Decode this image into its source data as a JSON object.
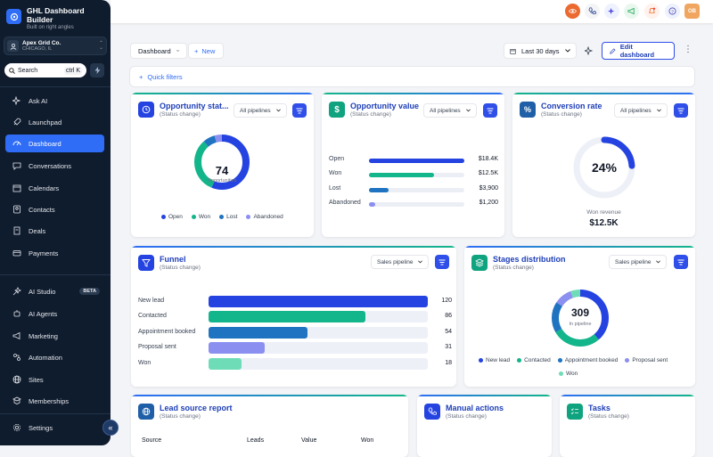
{
  "sidebar": {
    "brand_title": "GHL Dashboard Builder",
    "brand_sub": "Built on right angles",
    "account_name": "Apex Grid Co.",
    "account_location": "CHICAGO, IL",
    "search_label": "Search",
    "search_shortcut": "ctrl K",
    "nav": [
      {
        "label": "Ask AI",
        "icon": "sparkles-icon"
      },
      {
        "label": "Launchpad",
        "icon": "rocket-icon"
      },
      {
        "label": "Dashboard",
        "icon": "gauge-icon",
        "active": true
      },
      {
        "label": "Conversations",
        "icon": "chat-icon"
      },
      {
        "label": "Calendars",
        "icon": "calendar-icon"
      },
      {
        "label": "Contacts",
        "icon": "contacts-icon"
      },
      {
        "label": "Deals",
        "icon": "deals-icon"
      },
      {
        "label": "Payments",
        "icon": "card-icon"
      }
    ],
    "nav2": [
      {
        "label": "AI Studio",
        "icon": "studio-icon",
        "badge": "BETA"
      },
      {
        "label": "AI Agents",
        "icon": "agent-icon"
      },
      {
        "label": "Marketing",
        "icon": "megaphone-icon"
      },
      {
        "label": "Automation",
        "icon": "automation-icon"
      },
      {
        "label": "Sites",
        "icon": "globe-icon"
      },
      {
        "label": "Memberships",
        "icon": "members-icon"
      }
    ],
    "settings_label": "Settings",
    "avatar_initials": "OB"
  },
  "toolbar": {
    "dashboard_select": "Dashboard",
    "new_label": "New",
    "date_range": "Last 30 days",
    "edit_label": "Edit dashboard",
    "quick_filters": "Quick filters"
  },
  "cards": {
    "opp_status": {
      "title": "Opportunity stat...",
      "sub": "(Status change)",
      "pipeline": "All pipelines",
      "total": "74",
      "total_label": "Opportunities",
      "legend": [
        "Open",
        "Won",
        "Lost",
        "Abandoned"
      ]
    },
    "opp_value": {
      "title": "Opportunity value",
      "sub": "(Status change)",
      "pipeline": "All pipelines",
      "rows": [
        {
          "label": "Open",
          "value": "$18.4K",
          "fill": 1.0,
          "color": "#2443e0"
        },
        {
          "label": "Won",
          "value": "$12.5K",
          "fill": 0.68,
          "color": "#13b58a"
        },
        {
          "label": "Lost",
          "value": "$3,900",
          "fill": 0.21,
          "color": "#1f73c0"
        },
        {
          "label": "Abandoned",
          "value": "$1,200",
          "fill": 0.065,
          "color": "#8b8ff0"
        }
      ]
    },
    "conversion": {
      "title": "Conversion rate",
      "sub": "(Status change)",
      "pipeline": "All pipelines",
      "rate": "24%",
      "rate_fraction": 0.24,
      "won_label": "Won revenue",
      "won_value": "$12.5K"
    },
    "funnel": {
      "title": "Funnel",
      "sub": "(Status change)",
      "pipeline": "Sales pipeline",
      "rows": [
        {
          "label": "New lead",
          "value": "120",
          "fill": 1.0,
          "color": "#2443e0"
        },
        {
          "label": "Contacted",
          "value": "86",
          "fill": 0.717,
          "color": "#13b58a"
        },
        {
          "label": "Appointment booked",
          "value": "54",
          "fill": 0.45,
          "color": "#1f73c0"
        },
        {
          "label": "Proposal sent",
          "value": "31",
          "fill": 0.258,
          "color": "#8b8ff0"
        },
        {
          "label": "Won",
          "value": "18",
          "fill": 0.15,
          "color": "#6fdcb8"
        }
      ]
    },
    "stages": {
      "title": "Stages distribution",
      "sub": "(Status change)",
      "pipeline": "Sales pipeline",
      "total": "309",
      "total_label": "In pipeline",
      "legend": [
        "New lead",
        "Contacted",
        "Appointment booked",
        "Proposal sent",
        "Won"
      ]
    },
    "lead_source": {
      "title": "Lead source report",
      "sub": "(Status change)",
      "columns": [
        "Source",
        "Leads",
        "Value",
        "Won"
      ]
    },
    "manual": {
      "title": "Manual actions",
      "sub": "(Status change)"
    },
    "tasks": {
      "title": "Tasks",
      "sub": "(Status change)"
    }
  },
  "colors": {
    "blue": "#2443e0",
    "green": "#13b58a",
    "teal": "#1f73c0",
    "lavender": "#8b8ff0",
    "mint": "#6fdcb8"
  }
}
